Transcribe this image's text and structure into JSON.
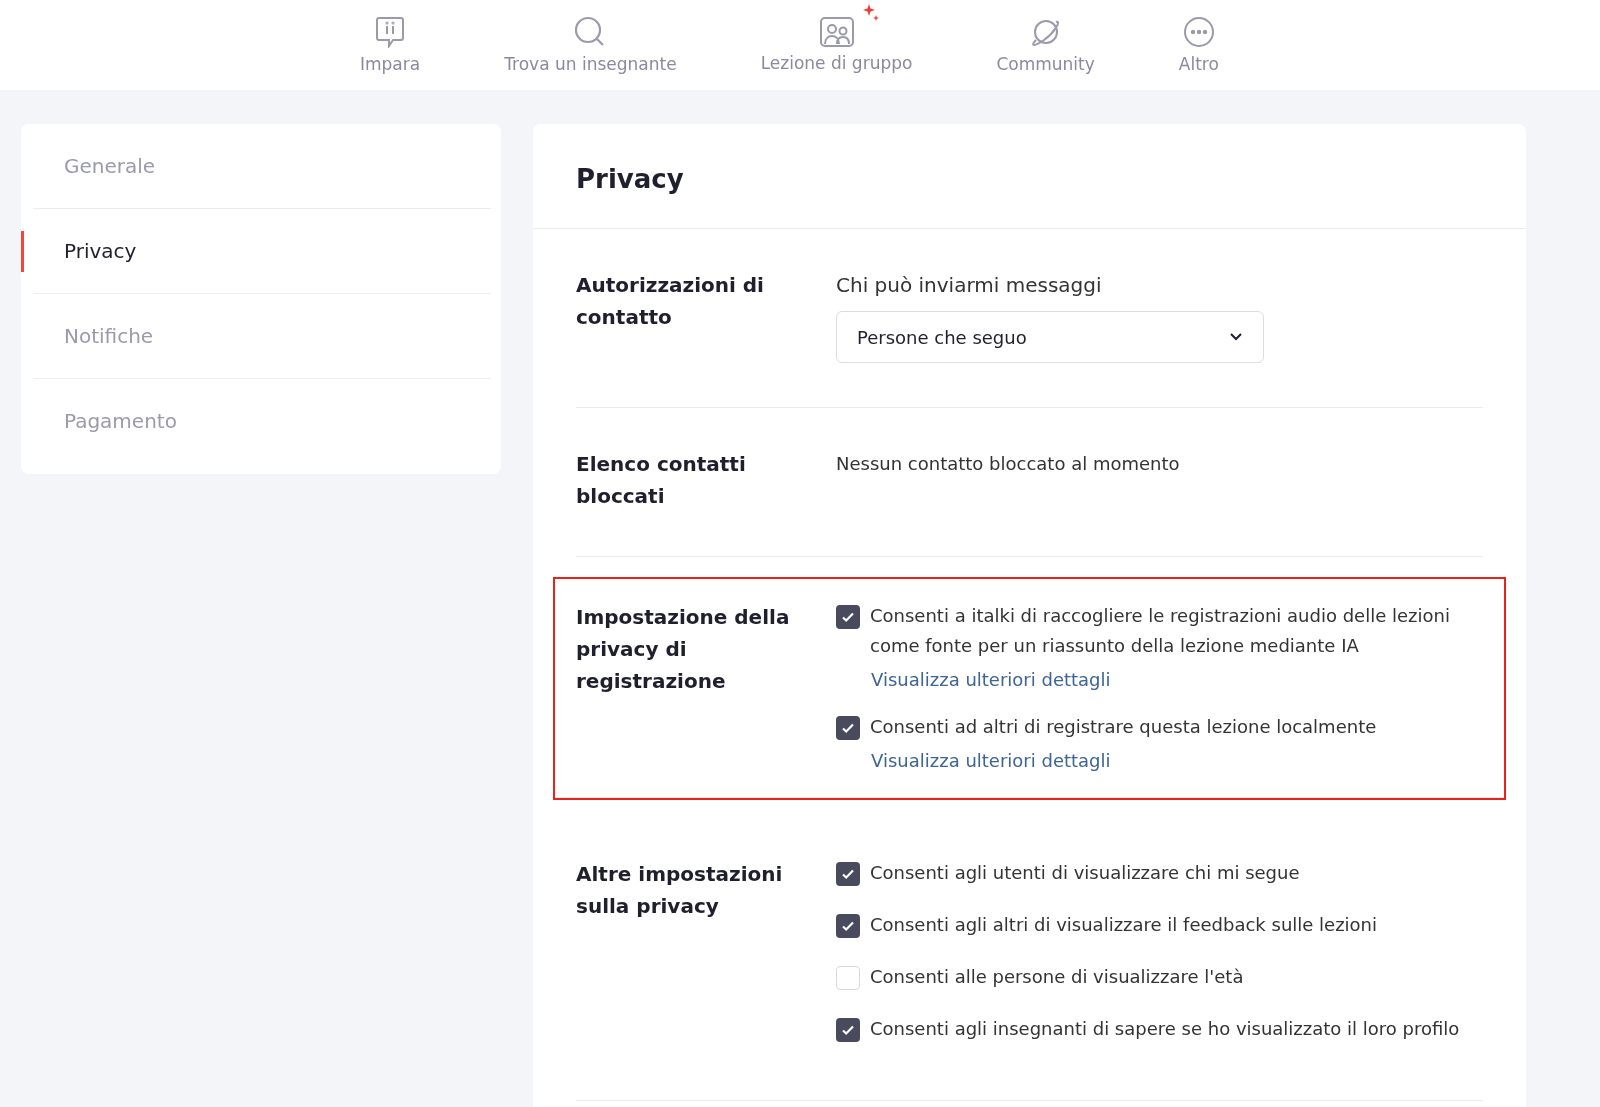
{
  "nav": [
    {
      "label": "Impara",
      "sparkle": false
    },
    {
      "label": "Trova un insegnante",
      "sparkle": false
    },
    {
      "label": "Lezione di gruppo",
      "sparkle": true
    },
    {
      "label": "Community",
      "sparkle": false
    },
    {
      "label": "Altro",
      "sparkle": false
    }
  ],
  "sidebar": {
    "items": [
      {
        "label": "Generale",
        "selected": false
      },
      {
        "label": "Privacy",
        "selected": true
      },
      {
        "label": "Notifiche",
        "selected": false
      },
      {
        "label": "Pagamento",
        "selected": false
      }
    ]
  },
  "panel": {
    "title": "Privacy",
    "sections": [
      {
        "kind": "select",
        "label": "Autorizzazioni di contatto",
        "highlighted": false,
        "caption": "Chi può inviarmi messaggi",
        "value": "Persone che seguo"
      },
      {
        "kind": "text",
        "label": "Elenco contatti bloccati",
        "highlighted": false,
        "text": "Nessun contatto bloccato al momento"
      },
      {
        "kind": "checkboxes",
        "label": "Impostazione della privacy di registrazione",
        "highlighted": true,
        "options": [
          {
            "label": "Consenti a italki di raccogliere le registrazioni audio delle lezioni come fonte per un riassunto della lezione mediante IA",
            "checked": true,
            "link": "Visualizza ulteriori dettagli"
          },
          {
            "label": "Consenti ad altri di registrare questa lezione localmente",
            "checked": true,
            "link": "Visualizza ulteriori dettagli"
          }
        ]
      },
      {
        "kind": "checkboxes",
        "label": "Altre impostazioni sulla privacy",
        "highlighted": false,
        "options": [
          {
            "label": "Consenti agli utenti di visualizzare chi mi segue",
            "checked": true
          },
          {
            "label": "Consenti agli altri di visualizzare il feedback sulle lezioni",
            "checked": true
          },
          {
            "label": "Consenti alle persone di visualizzare l'età",
            "checked": false
          },
          {
            "label": "Consenti agli insegnanti di sapere se ho visualizzato il loro profilo",
            "checked": true
          }
        ]
      }
    ]
  }
}
